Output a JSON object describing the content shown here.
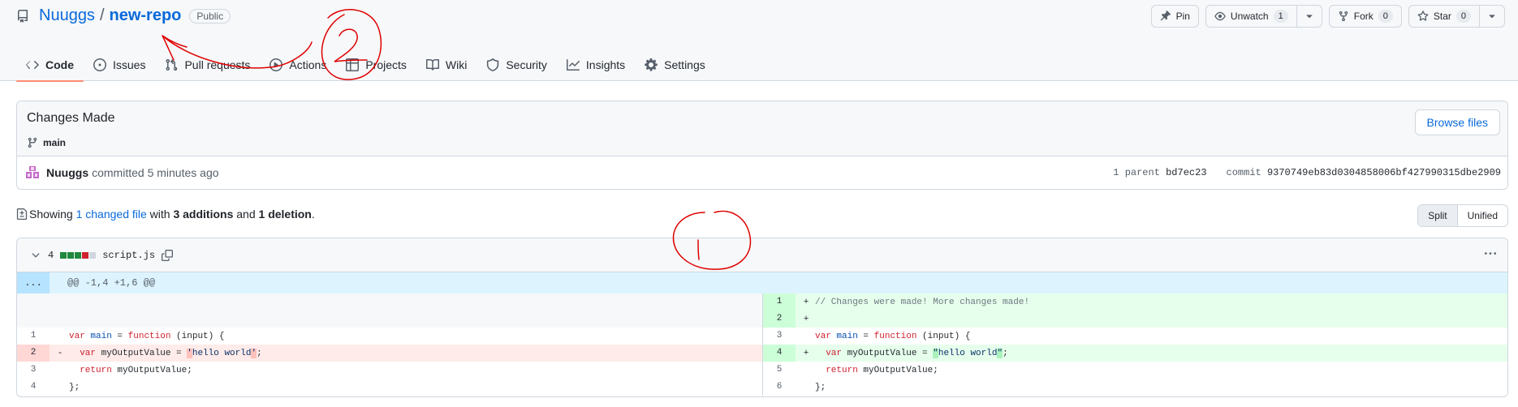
{
  "repo": {
    "owner": "Nuuggs",
    "separator": "/",
    "name": "new-repo",
    "visibility": "Public"
  },
  "actions": {
    "pin": "Pin",
    "unwatch": "Unwatch",
    "unwatch_count": "1",
    "fork": "Fork",
    "fork_count": "0",
    "star": "Star",
    "star_count": "0"
  },
  "tabs": [
    {
      "label": "Code",
      "icon": "code-icon"
    },
    {
      "label": "Issues",
      "icon": "issue-icon"
    },
    {
      "label": "Pull requests",
      "icon": "pull-request-icon"
    },
    {
      "label": "Actions",
      "icon": "play-icon"
    },
    {
      "label": "Projects",
      "icon": "table-icon"
    },
    {
      "label": "Wiki",
      "icon": "book-icon"
    },
    {
      "label": "Security",
      "icon": "shield-icon"
    },
    {
      "label": "Insights",
      "icon": "graph-icon"
    },
    {
      "label": "Settings",
      "icon": "gear-icon"
    }
  ],
  "commit": {
    "title": "Changes Made",
    "branch": "main",
    "browse_label": "Browse files",
    "author": "Nuuggs",
    "meta": "committed 5 minutes ago",
    "parent_label": "1 parent",
    "parent_sha": "bd7ec23",
    "commit_label": "commit",
    "commit_sha": "9370749eb83d0304858006bf427990315dbe2909"
  },
  "diffstat": {
    "prefix": "Showing",
    "changed": "1 changed file",
    "with": "with",
    "additions": "3 additions",
    "and": "and",
    "deletions": "1 deletion",
    "suffix": ".",
    "split": "Split",
    "unified": "Unified"
  },
  "file": {
    "changes": "4",
    "name": "script.js",
    "hunk_expand": "...",
    "hunk": "@@ -1,4 +1,6 @@",
    "left": [
      {
        "num": "",
        "type": "empty",
        "marker": "",
        "code": ""
      },
      {
        "num": "",
        "type": "empty",
        "marker": "",
        "code": ""
      },
      {
        "num": "1",
        "type": "ctx",
        "marker": "",
        "code": "var main = function (input) {"
      },
      {
        "num": "2",
        "type": "del",
        "marker": "-",
        "code": "  var myOutputValue = 'hello world';"
      },
      {
        "num": "3",
        "type": "ctx",
        "marker": "",
        "code": "  return myOutputValue;"
      },
      {
        "num": "4",
        "type": "ctx",
        "marker": "",
        "code": "};"
      }
    ],
    "right": [
      {
        "num": "1",
        "type": "add",
        "marker": "+",
        "code": "// Changes were made! More changes made!"
      },
      {
        "num": "2",
        "type": "add",
        "marker": "+",
        "code": ""
      },
      {
        "num": "3",
        "type": "ctx",
        "marker": "",
        "code": "var main = function (input) {"
      },
      {
        "num": "4",
        "type": "add",
        "marker": "+",
        "code": "  var myOutputValue = \"hello world\";"
      },
      {
        "num": "5",
        "type": "ctx",
        "marker": "",
        "code": "  return myOutputValue;"
      },
      {
        "num": "6",
        "type": "ctx",
        "marker": "",
        "code": "};"
      }
    ]
  },
  "colors": {
    "accent": "#0969da",
    "tab_underline": "#fd8c73",
    "annotation": "#e00000"
  }
}
